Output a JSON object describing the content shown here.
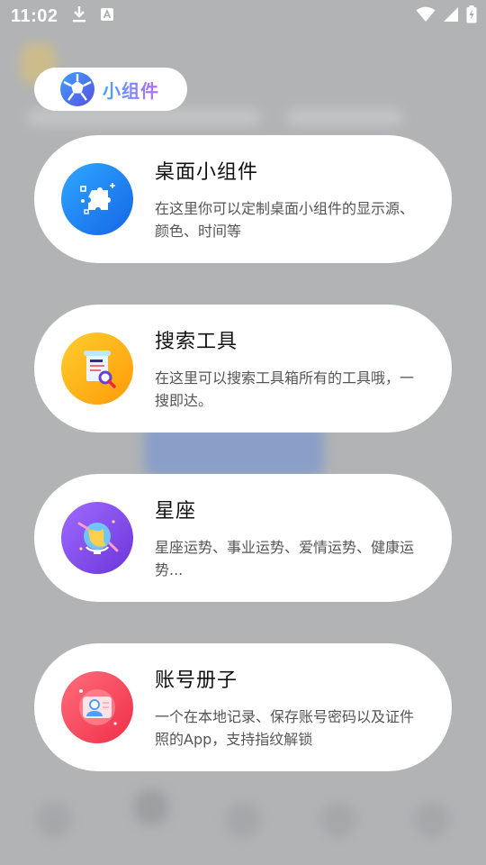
{
  "status_bar": {
    "time": "11:02",
    "icons": [
      "download-icon",
      "a-notification-icon",
      "wifi-icon",
      "signal-icon",
      "battery-charging-icon"
    ]
  },
  "widget_pill": {
    "label": "小组件",
    "icon": "soccer-ball-logo-icon"
  },
  "cards": [
    {
      "title": "桌面小组件",
      "desc": "在这里你可以定制桌面小组件的显示源、颜色、时间等",
      "icon": "puzzle-icon",
      "color": "#1e7cf2"
    },
    {
      "title": "搜索工具",
      "desc": "在这里可以搜索工具箱所有的工具哦，一搜即达。",
      "icon": "document-search-icon",
      "color": "#ffb31a"
    },
    {
      "title": "星座",
      "desc": "星座运势、事业运势、爱情运势、健康运势...",
      "icon": "globe-constellation-icon",
      "color": "#8b54f0"
    },
    {
      "title": "账号册子",
      "desc": "一个在本地记录、保存账号密码以及证件照的App，支持指纹解锁",
      "icon": "id-card-icon",
      "color": "#f5435a"
    }
  ]
}
